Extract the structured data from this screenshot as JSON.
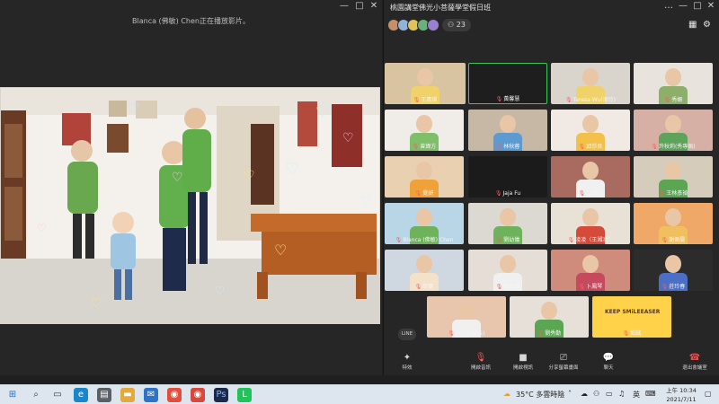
{
  "share": {
    "status": "Blanca (佛敏) Chen正在播放影片。",
    "controls": {
      "minimize": "—",
      "maximize": "□",
      "close": "✕"
    }
  },
  "meeting": {
    "title": "桃園講堂佛光小菩薩學堂假日班",
    "participant_count": "23",
    "window_controls": {
      "more": "…",
      "minimize": "—",
      "maximize": "□",
      "close": "✕"
    },
    "view_icon": "gallery-view-icon",
    "settings_icon": "gear-icon",
    "tiles": [
      {
        "name": "王惠琪"
      },
      {
        "name": "黃馨慧"
      },
      {
        "name": "Teresa Wu(淑玲)"
      },
      {
        "name": "秀姍"
      },
      {
        "name": "曾瑋方"
      },
      {
        "name": "林秋蓉"
      },
      {
        "name": "邱莎良"
      },
      {
        "name": "許秋莉(秀專佩)"
      },
      {
        "name": "覺妍"
      },
      {
        "name": "Jaja Fu"
      },
      {
        "name": "江重珍"
      },
      {
        "name": "王林彥禎"
      },
      {
        "name": "Blanca (佛敏) Chen"
      },
      {
        "name": "劉幼儀"
      },
      {
        "name": "凌凌（王湘凌）"
      },
      {
        "name": "謝佩晏"
      },
      {
        "name": "欣宴"
      },
      {
        "name": "賴彥嚴"
      },
      {
        "name": "卜鳳琴"
      },
      {
        "name": "莊玲春"
      },
      {
        "name": "YU (元友云)"
      },
      {
        "name": "劉秀勤"
      },
      {
        "name": "如誠"
      }
    ],
    "tile_badge": "KEEP SMiLEEASER",
    "line_badge": "LINE",
    "toolbar": [
      {
        "icon": "sparkle-icon",
        "label": "特效"
      },
      {
        "icon": "mic-muted-icon",
        "label": "開啟音訊"
      },
      {
        "icon": "video-icon",
        "label": "開啟視訊"
      },
      {
        "icon": "share-screen-icon",
        "label": "分享螢幕畫面"
      },
      {
        "icon": "chat-icon",
        "label": "聊天"
      },
      {
        "icon": "leave-icon",
        "label": "退出會議室"
      }
    ]
  },
  "taskbar": {
    "weather": "35°C  多雲時陰",
    "ime": "英",
    "time": "上午 10:34",
    "date": "2021/7/11"
  },
  "colors": {
    "accent_green": "#3cc35a",
    "muted_red": "#ff5b5b",
    "leave_red": "#e05252"
  }
}
